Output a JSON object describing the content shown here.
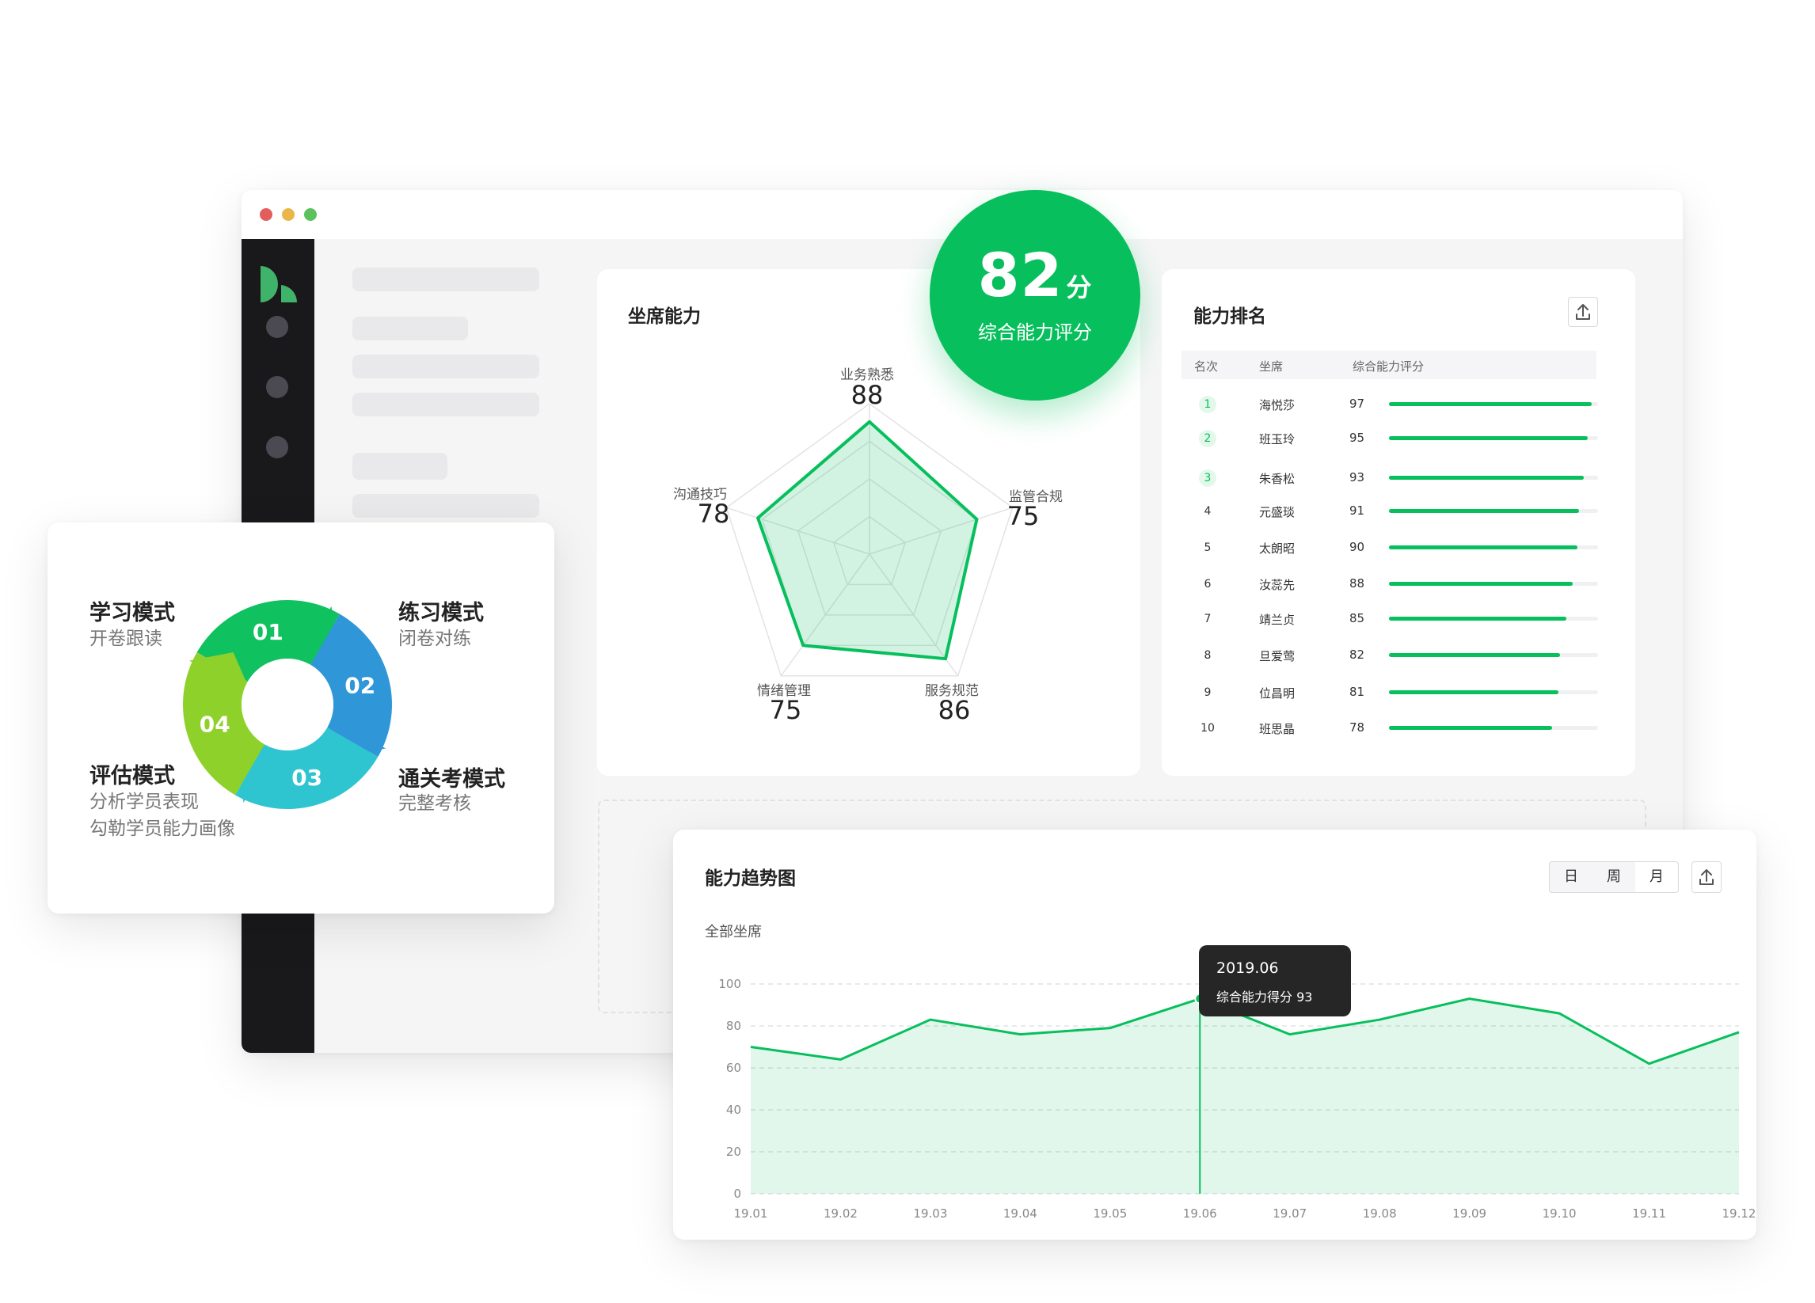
{
  "window": {
    "dots": [
      "#e35d5b",
      "#e9b64a",
      "#5cc05c"
    ]
  },
  "score": {
    "value": "82",
    "unit": "分",
    "label": "综合能力评分"
  },
  "radar": {
    "title": "坐席能力",
    "axes": [
      {
        "label": "业务熟悉",
        "value": 88
      },
      {
        "label": "监管合规",
        "value": 75
      },
      {
        "label": "服务规范",
        "value": 86
      },
      {
        "label": "情绪管理",
        "value": 75
      },
      {
        "label": "沟通技巧",
        "value": 78
      }
    ]
  },
  "ranking": {
    "title": "能力排名",
    "export_icon": "upload-icon",
    "headers": [
      "名次",
      "坐席",
      "综合能力评分"
    ],
    "rows": [
      {
        "rank": "1",
        "name": "海悦莎",
        "score": 97
      },
      {
        "rank": "2",
        "name": "班玉玲",
        "score": 95
      },
      {
        "rank": "3",
        "name": "朱香松",
        "score": 93
      },
      {
        "rank": "4",
        "name": "元盛琰",
        "score": 91
      },
      {
        "rank": "5",
        "name": "太朗昭",
        "score": 90
      },
      {
        "rank": "6",
        "name": "汝蕊先",
        "score": 88
      },
      {
        "rank": "7",
        "name": "靖兰贞",
        "score": 85
      },
      {
        "rank": "8",
        "name": "旦爱莺",
        "score": 82
      },
      {
        "rank": "9",
        "name": "位昌明",
        "score": 81
      },
      {
        "rank": "10",
        "name": "班思晶",
        "score": 78
      }
    ]
  },
  "modes": {
    "items": [
      {
        "num": "01",
        "title": "学习模式",
        "sub": [
          "开卷跟读"
        ],
        "color": "#10c160"
      },
      {
        "num": "02",
        "title": "练习模式",
        "sub": [
          "闭卷对练"
        ],
        "color": "#2f96d8"
      },
      {
        "num": "03",
        "title": "通关考模式",
        "sub": [
          "完整考核"
        ],
        "color": "#2ec5d1"
      },
      {
        "num": "04",
        "title": "评估模式",
        "sub": [
          "分析学员表现",
          "勾勒学员能力画像"
        ],
        "color": "#8fd12b"
      }
    ]
  },
  "trend": {
    "title": "能力趋势图",
    "filters": [
      "日",
      "周",
      "月"
    ],
    "subtitle": "全部坐席",
    "tooltip": {
      "date": "2019.06",
      "label": "综合能力得分",
      "value": "93"
    }
  },
  "chart_data": {
    "type": "area",
    "title": "能力趋势图",
    "x": [
      "19.01",
      "19.02",
      "19.03",
      "19.04",
      "19.05",
      "19.06",
      "19.07",
      "19.08",
      "19.09",
      "19.10",
      "19.11",
      "19.12"
    ],
    "series": [
      {
        "values": [
          70,
          64,
          83,
          76,
          79,
          93,
          76,
          83,
          93,
          86,
          62,
          77
        ]
      }
    ],
    "ylim": [
      0,
      100
    ],
    "yticks": [
      0,
      20,
      40,
      60,
      80,
      100
    ],
    "grid": true
  }
}
